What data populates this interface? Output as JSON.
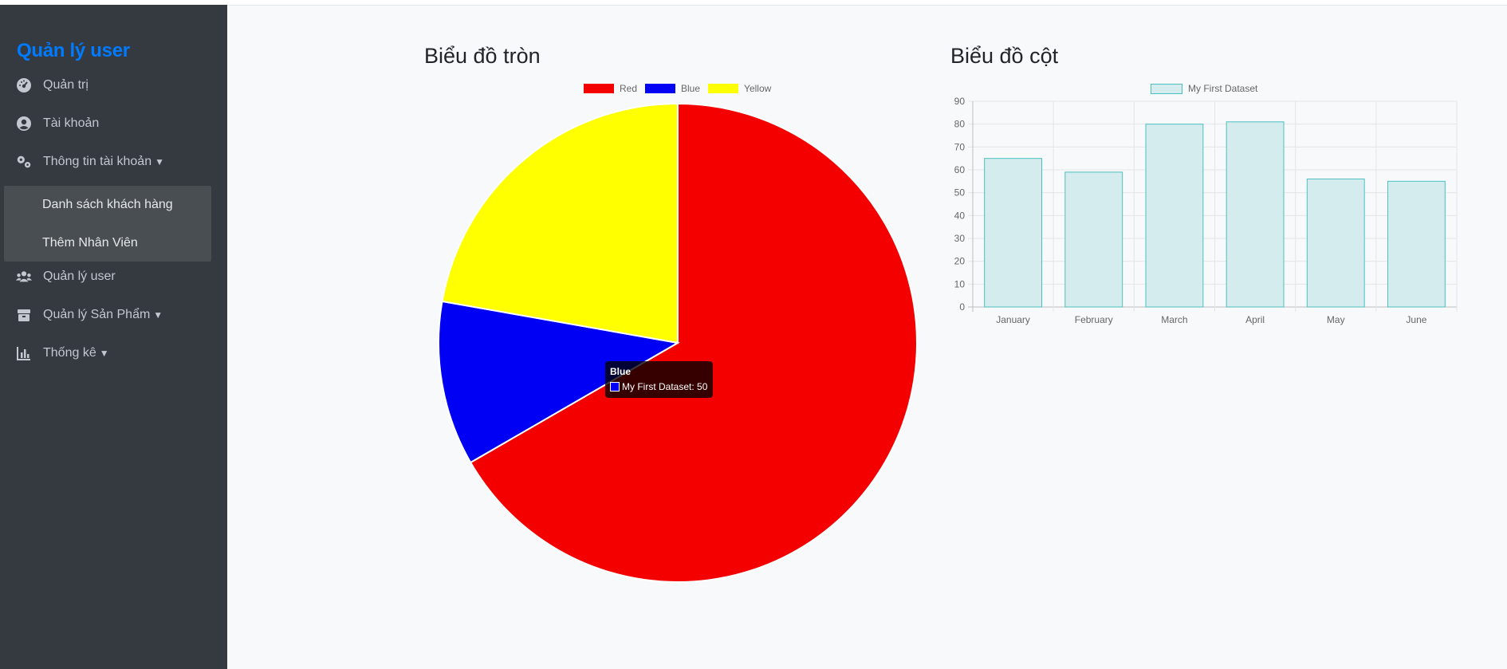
{
  "sidebar": {
    "brand": "Quản lý user",
    "items": [
      {
        "label": "Quản trị",
        "icon": "dashboard-icon"
      },
      {
        "label": "Tài khoản",
        "icon": "user-circle-icon"
      },
      {
        "label": "Thông tin tài khoản",
        "icon": "cogs-icon",
        "caret": "▼"
      },
      {
        "label": "Quản lý user",
        "icon": "users-icon"
      },
      {
        "label": "Quản lý Sản Phẩm",
        "icon": "box-icon",
        "caret": "▼"
      },
      {
        "label": "Thống kê",
        "icon": "chart-icon",
        "caret": "▼"
      }
    ],
    "submenu": [
      {
        "label": "Danh sách khách hàng"
      },
      {
        "label": "Thêm Nhân Viên"
      }
    ]
  },
  "pie_panel": {
    "title": "Biểu đồ tròn",
    "tooltip": {
      "title": "Blue",
      "body": "My First Dataset: 50"
    }
  },
  "bar_panel": {
    "title": "Biểu đồ cột"
  },
  "colors": {
    "accent": "#007bff",
    "sidebar_bg": "#343a40",
    "submenu_bg": "#494e53"
  },
  "chart_data": [
    {
      "type": "pie",
      "categories": [
        "Red",
        "Blue",
        "Yellow"
      ],
      "series": [
        {
          "name": "My First Dataset",
          "values": [
            300,
            50,
            100
          ]
        }
      ],
      "colors": [
        "#f50000",
        "#0000f5",
        "#ffff00"
      ],
      "legend": "top"
    },
    {
      "type": "bar",
      "categories": [
        "January",
        "February",
        "March",
        "April",
        "May",
        "June"
      ],
      "series": [
        {
          "name": "My First Dataset",
          "values": [
            65,
            59,
            80,
            81,
            56,
            55
          ]
        }
      ],
      "ylim": [
        0,
        90
      ],
      "yticks": [
        0,
        10,
        20,
        30,
        40,
        50,
        60,
        70,
        80,
        90
      ],
      "grid": true,
      "legend": "top",
      "colors": [
        "#d4ecee",
        "#4bc0c0"
      ]
    }
  ]
}
